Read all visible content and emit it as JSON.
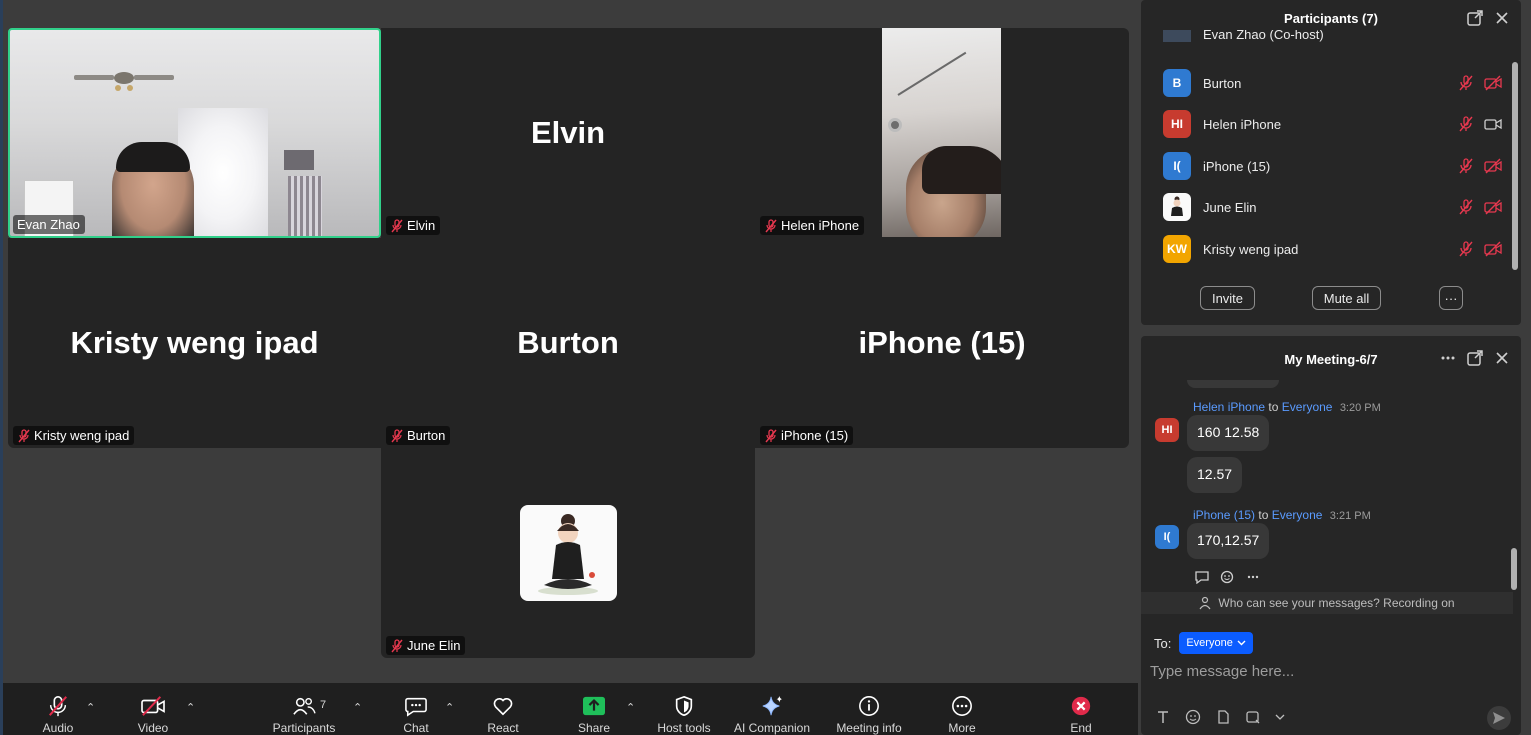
{
  "gallery": {
    "tiles": [
      {
        "name": "Evan Zhao"
      },
      {
        "name": "Elvin",
        "tag": "Elvin"
      },
      {
        "name": "Helen iPhone"
      },
      {
        "name": "Kristy weng ipad",
        "tag": "Kristy weng ipad"
      },
      {
        "name": "Burton",
        "tag": "Burton"
      },
      {
        "name": "iPhone (15)",
        "tag": "iPhone (15)"
      },
      {
        "name": "June Elin"
      }
    ]
  },
  "toolbar": {
    "audio": "Audio",
    "video": "Video",
    "participants": "Participants",
    "participants_count": "7",
    "chat": "Chat",
    "react": "React",
    "share": "Share",
    "host_tools": "Host tools",
    "ai_companion": "AI Companion",
    "meeting_info": "Meeting info",
    "more": "More",
    "end": "End",
    "accent_share": "#1fbf5a",
    "accent_end": "#e02a4a"
  },
  "participants_panel": {
    "title": "Participants (7)",
    "partial_row": "Evan Zhao (Co-host)",
    "rows": [
      {
        "initials": "B",
        "name": "Burton",
        "color": "#2f7ad1"
      },
      {
        "initials": "HI",
        "name": "Helen iPhone",
        "color": "#c73b2f"
      },
      {
        "initials": "I(",
        "name": "iPhone (15)",
        "color": "#2f7ad1"
      },
      {
        "initials": "",
        "name": "June Elin",
        "color": "#fafafa"
      },
      {
        "initials": "KW",
        "name": "Kristy weng ipad",
        "color": "#f2a500"
      }
    ],
    "invite": "Invite",
    "mute_all": "Mute all",
    "more": "···",
    "muted_color": "#e8384f"
  },
  "chat_panel": {
    "title": "My Meeting-6/7",
    "messages": [
      {
        "initials": "HI",
        "sender": "Helen iPhone",
        "to_label": "to",
        "recipient": "Everyone",
        "time": "3:20 PM",
        "color": "#c73b2f",
        "lines": [
          "160 12.58",
          "12.57"
        ]
      },
      {
        "initials": "I(",
        "sender": "iPhone (15)",
        "to_label": "to",
        "recipient": "Everyone",
        "time": "3:21 PM",
        "color": "#2f7ad1",
        "lines": [
          "170,12.57"
        ]
      }
    ],
    "notice": "Who can see your messages? Recording on",
    "to_label": "To:",
    "to_value": "Everyone",
    "placeholder": "Type message here..."
  }
}
